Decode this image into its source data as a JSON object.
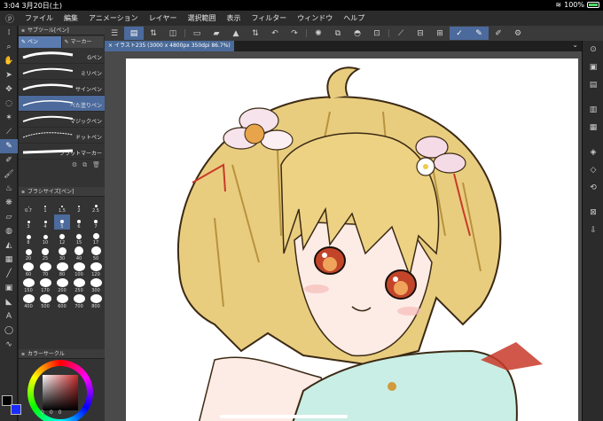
{
  "status": {
    "time": "3:04",
    "date": "3月20日(土)",
    "battery": "100%"
  },
  "menu": {
    "items": [
      "ファイル",
      "編集",
      "アニメーション",
      "レイヤー",
      "選択範囲",
      "表示",
      "フィルター",
      "ウィンドウ",
      "ヘルプ"
    ]
  },
  "document": {
    "tab_label": "イラスト235 (3000 x 4800px 350dpi 86.7%)"
  },
  "subtool": {
    "panel_title": "サブツール[ペン]",
    "tabs": [
      "ペン",
      "マーカー"
    ],
    "brushes": [
      "Gペン",
      "ミリペン",
      "サインペン",
      "べた塗りペン",
      "マジックペン",
      "ドットペン",
      "フラットマーカー"
    ],
    "selected_index": 3
  },
  "brush_size": {
    "panel_title": "ブラシサイズ[ペン]",
    "sizes": [
      "0.7",
      "1",
      "1.5",
      "2",
      "2.5",
      "3",
      "4",
      "5",
      "6",
      "7",
      "8",
      "10",
      "12",
      "15",
      "17",
      "20",
      "25",
      "30",
      "40",
      "50",
      "60",
      "70",
      "80",
      "100",
      "120",
      "150",
      "170",
      "200",
      "250",
      "300",
      "400",
      "500",
      "600",
      "700",
      "800"
    ],
    "selected": "5"
  },
  "color": {
    "panel_title": "カラーサークル",
    "main": "#000000",
    "sub": "#1a2cff",
    "accent": "#c8282a"
  },
  "bottom_info": {
    "values": [
      "0",
      "0",
      "0"
    ]
  }
}
